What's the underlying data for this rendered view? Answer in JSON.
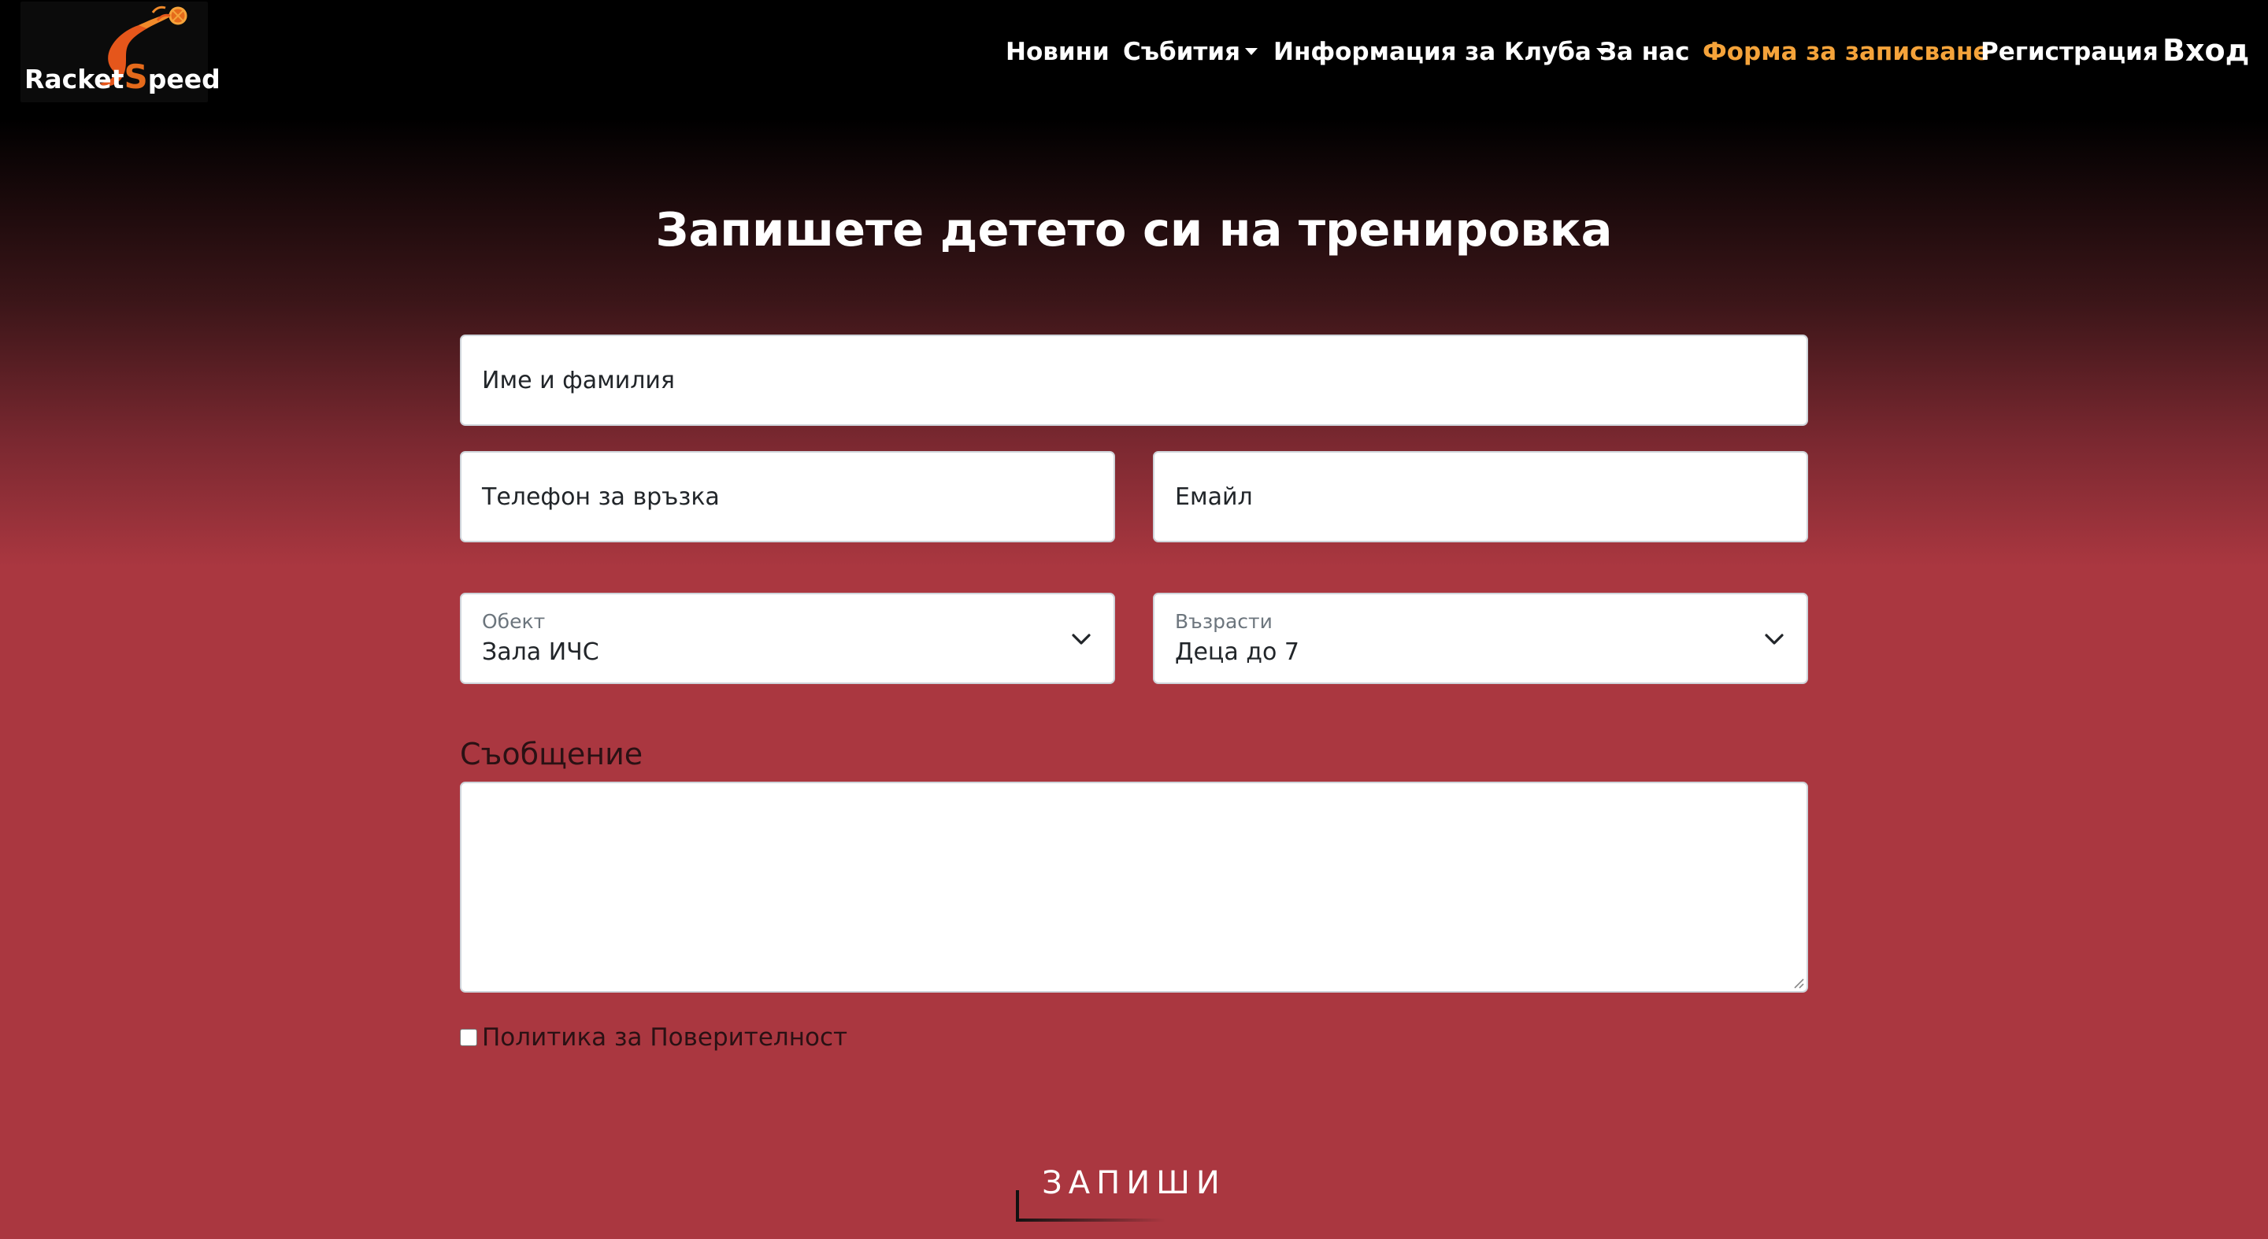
{
  "brand": {
    "logo_text_part1": "Racket",
    "logo_text_s": "S",
    "logo_text_part2": "peed"
  },
  "nav": {
    "items": [
      {
        "label": "Новини"
      },
      {
        "label": "Събития"
      },
      {
        "label": "Информация за Клуба"
      },
      {
        "label": "За нас"
      },
      {
        "label": "Форма за записване"
      },
      {
        "label": "Регистрация"
      }
    ],
    "login_label": "Вход"
  },
  "form": {
    "title": "Запишете детето си на тренировка",
    "name_placeholder": "Име и фамилия",
    "phone_placeholder": "Телефон за връзка",
    "email_placeholder": "Емайл",
    "venue": {
      "label": "Обект",
      "value": "Зала ИЧС"
    },
    "age": {
      "label": "Възрасти",
      "value": "Деца до 7"
    },
    "message_label": "Съобщение",
    "privacy_label": "Политика за Поверителност",
    "submit_label": "ЗАПИШИ"
  },
  "colors": {
    "accent_active": "#f5a33a",
    "background_red": "#aa3740",
    "navbar": "#000000"
  },
  "icons": {
    "logo": "racket-speed-logo-icon",
    "dropdown": "chevron-down-icon",
    "resize": "resize-grip-icon"
  }
}
